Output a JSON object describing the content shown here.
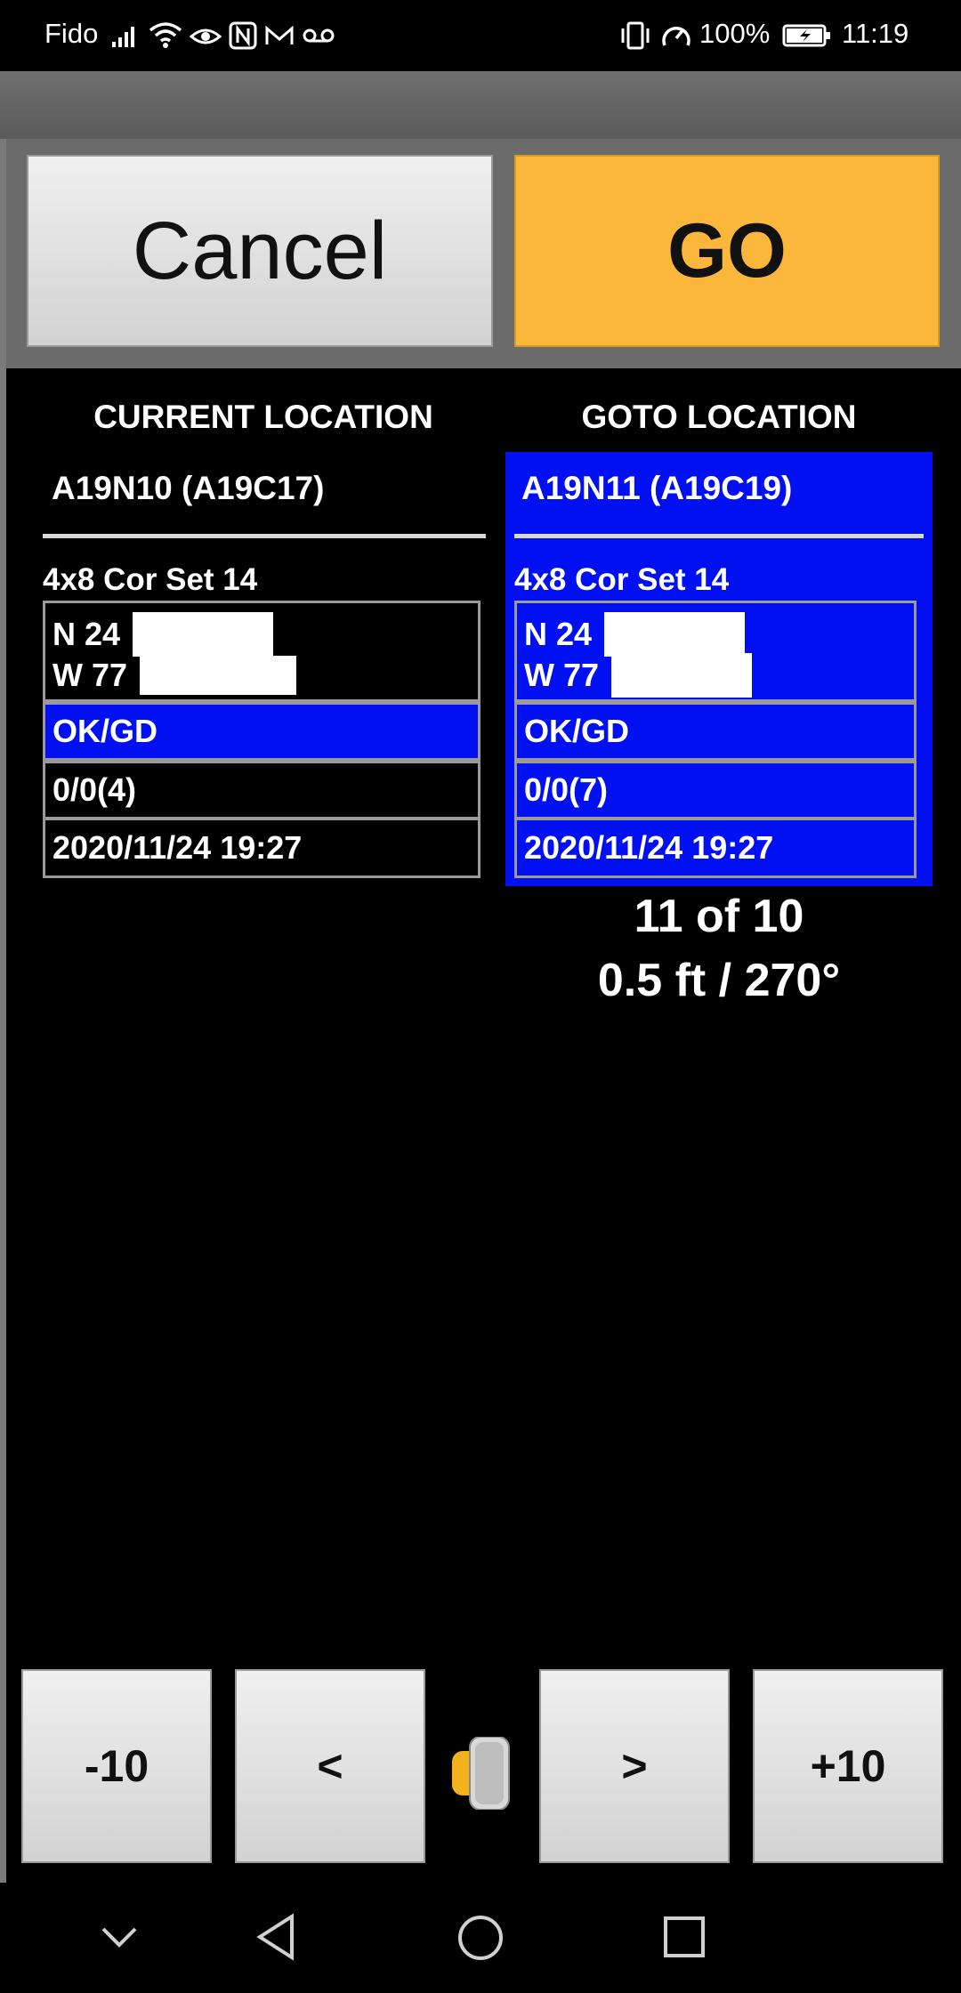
{
  "status_bar": {
    "carrier": "Fido",
    "battery": "100%",
    "time": "11:19"
  },
  "actions": {
    "cancel_label": "Cancel",
    "go_label": "GO"
  },
  "current": {
    "title": "CURRENT LOCATION",
    "code": "A19N10 (A19C17)",
    "set_name": "4x8 Cor Set 14",
    "lat_prefix": "N 24",
    "lon_prefix": "W 77",
    "status": "OK/GD",
    "count": "0/0(4)",
    "timestamp": "2020/11/24 19:27"
  },
  "goto": {
    "title": "GOTO LOCATION",
    "code": "A19N11 (A19C19)",
    "set_name": "4x8 Cor Set 14",
    "lat_prefix": "N 24",
    "lon_prefix": "W 77",
    "status": "OK/GD",
    "count": "0/0(7)",
    "timestamp": "2020/11/24 19:27"
  },
  "navigation_info": {
    "position": "11 of 10",
    "distance_bearing": "0.5 ft / 270°"
  },
  "controls": {
    "minus10": "-10",
    "prev": "<",
    "next": ">",
    "plus10": "+10"
  },
  "colors": {
    "accent": "#fbb73b",
    "highlight": "#0010f0"
  }
}
